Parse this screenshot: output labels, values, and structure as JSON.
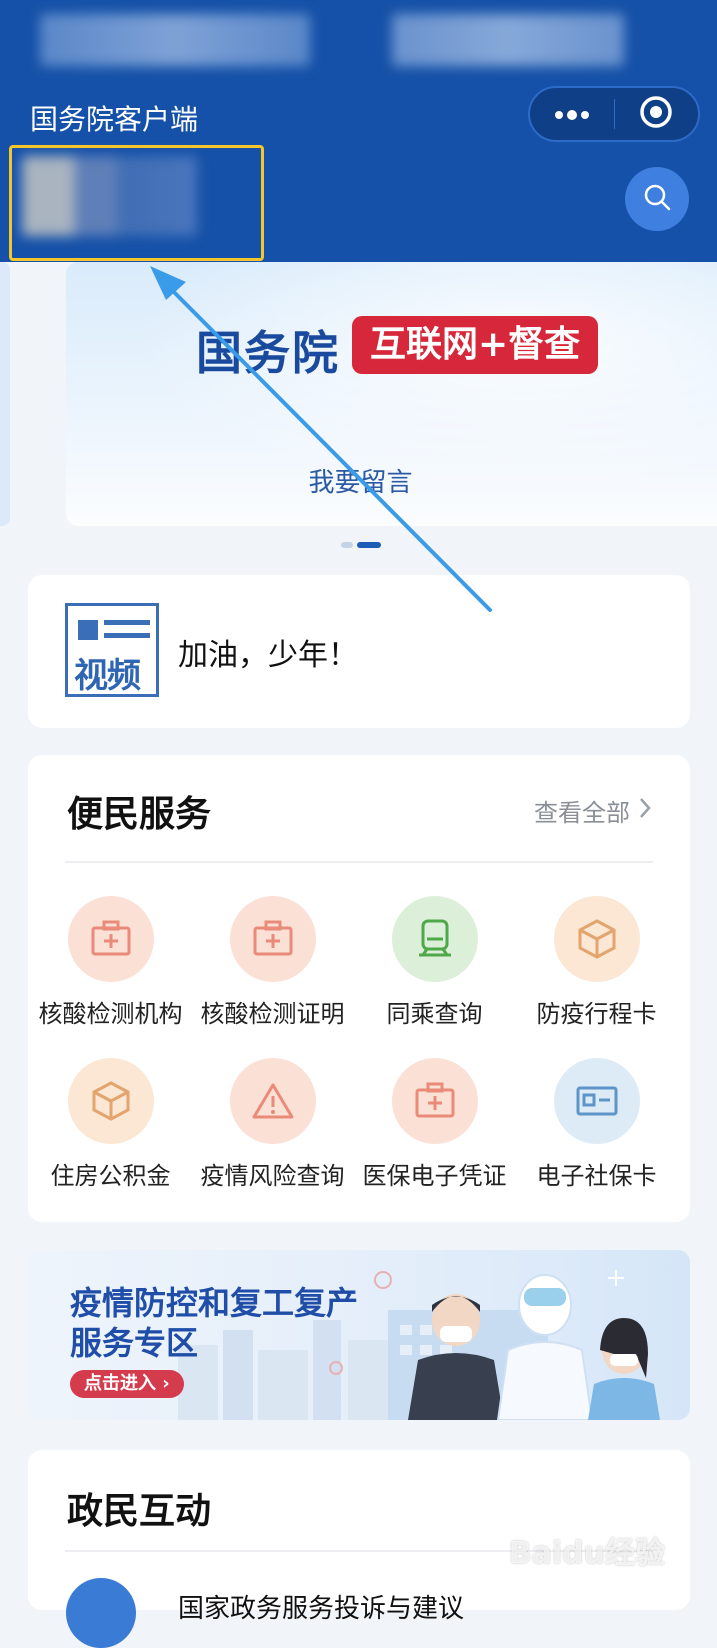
{
  "header": {
    "title": "国务院客户端",
    "more_icon": "more-dots-icon",
    "close_icon": "target-circle-icon",
    "search_icon": "search-icon",
    "bg_color": "#1551a8"
  },
  "banner": {
    "title": "国务院",
    "tag": "互联网+督查",
    "link": "我要留言",
    "page_count": 2,
    "active_page": 2
  },
  "video": {
    "icon_text": "视频",
    "text": "加油，少年！"
  },
  "services": {
    "title": "便民服务",
    "see_all": "查看全部",
    "items": [
      {
        "label": "核酸检测机构",
        "icon": "medical-kit-icon",
        "bg": "#fbe0d6"
      },
      {
        "label": "核酸检测证明",
        "icon": "medical-kit-icon",
        "bg": "#fbe0d6"
      },
      {
        "label": "同乘查询",
        "icon": "train-icon",
        "bg": "#dcefd8"
      },
      {
        "label": "防疫行程卡",
        "icon": "box-icon",
        "bg": "#fbe7d3"
      },
      {
        "label": "住房公积金",
        "icon": "box-icon",
        "bg": "#fbe7d3"
      },
      {
        "label": "疫情风险查询",
        "icon": "warning-icon",
        "bg": "#fbe0d6"
      },
      {
        "label": "医保电子凭证",
        "icon": "medical-kit-icon",
        "bg": "#fbe0d6"
      },
      {
        "label": "电子社保卡",
        "icon": "id-card-icon",
        "bg": "#dcebf6"
      }
    ]
  },
  "epidemic_banner": {
    "line1": "疫情防控和复工复产",
    "line2": "服务专区",
    "cta": "点击进入 ›"
  },
  "interaction": {
    "title": "政民互动",
    "first_item": "国家政务服务投诉与建议"
  },
  "watermark": "Baidu经验"
}
